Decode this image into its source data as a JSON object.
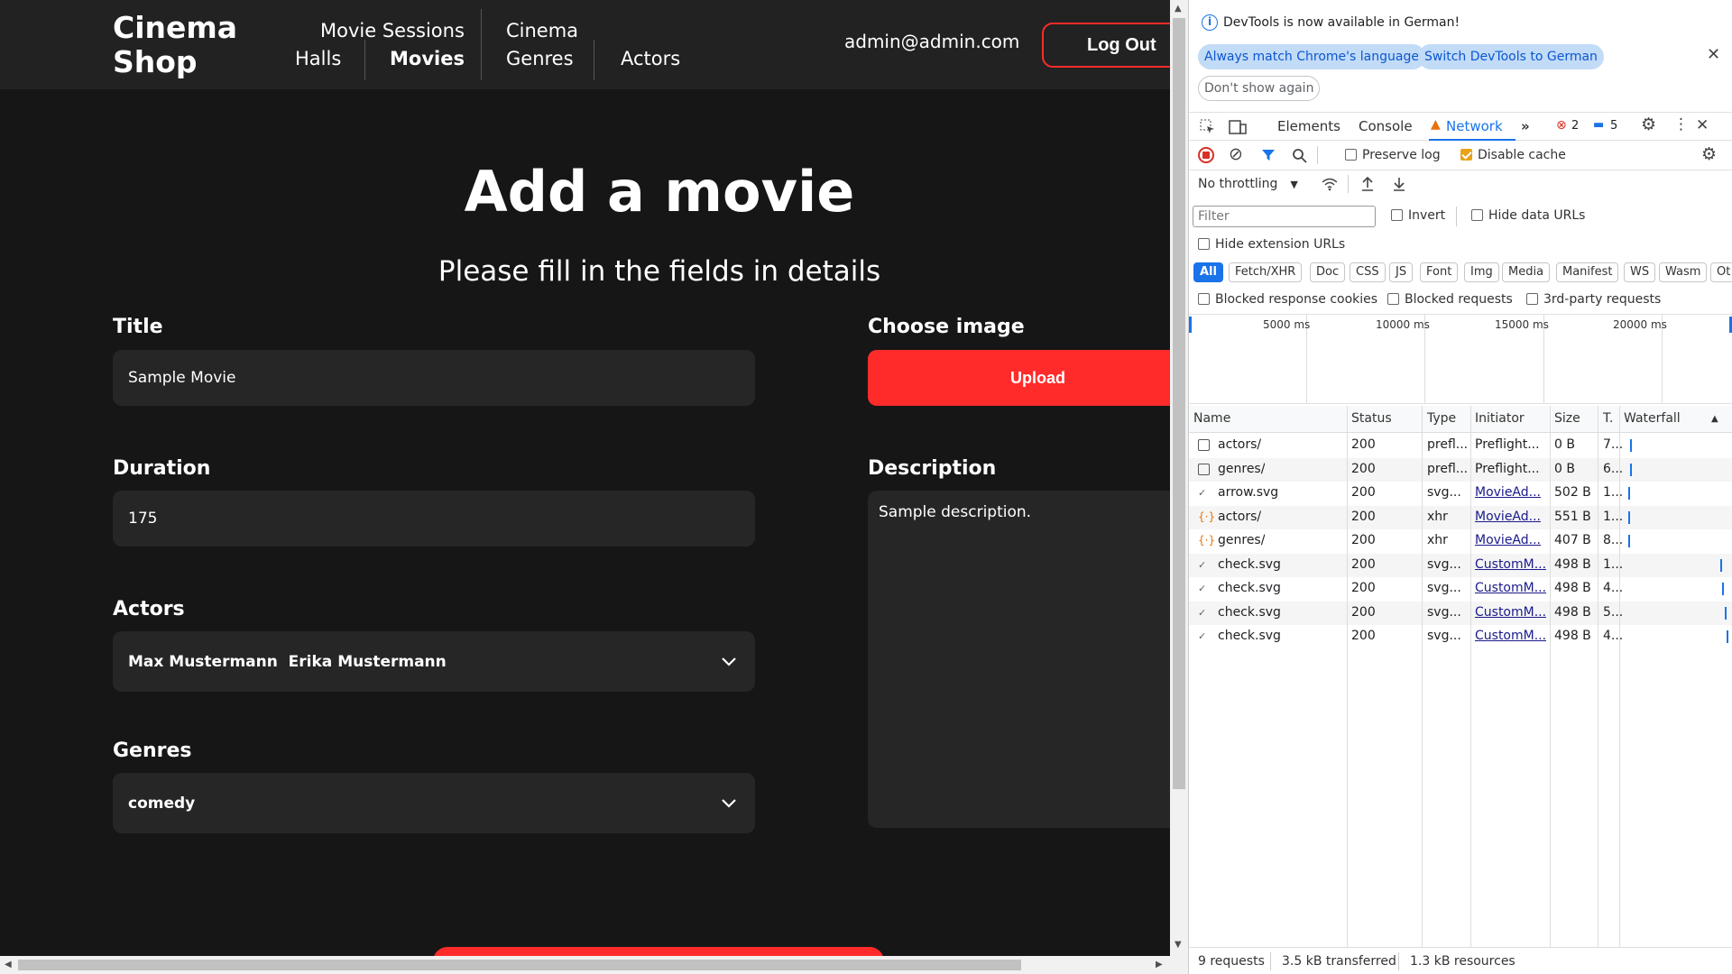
{
  "site": {
    "logo_line1": "Cinema",
    "logo_line2": "Shop",
    "nav": {
      "movie_sessions": "Movie Sessions",
      "halls": "Halls",
      "movies": "Movies",
      "cinema": "Cinema",
      "genres": "Genres",
      "actors": "Actors"
    },
    "user_email": "admin@admin.com",
    "logout_label": "Log Out"
  },
  "form": {
    "title": "Add a movie",
    "subtitle": "Please fill in the fields in details",
    "title_label": "Title",
    "title_value": "Sample  Movie",
    "duration_label": "Duration",
    "duration_value": "175",
    "actors_label": "Actors",
    "actors_value": "Max Mustermann  Erika Mustermann",
    "genres_label": "Genres",
    "genres_value": "comedy",
    "image_label": "Choose image",
    "upload_label": "Upload",
    "description_label": "Description",
    "description_value": "Sample description."
  },
  "devtools": {
    "info_text": "DevTools is now available in German!",
    "btn_match": "Always match Chrome's language",
    "btn_switch": "Switch DevTools to German",
    "btn_dont_show": "Don't show again",
    "tabs": {
      "elements": "Elements",
      "console": "Console",
      "network": "Network"
    },
    "error_count": "2",
    "message_count": "5",
    "preserve_log": "Preserve log",
    "disable_cache": "Disable cache",
    "throttling": "No throttling",
    "filter_placeholder": "Filter",
    "invert": "Invert",
    "hide_data_urls": "Hide data URLs",
    "hide_extension_urls": "Hide extension URLs",
    "types": [
      "All",
      "Fetch/XHR",
      "Doc",
      "CSS",
      "JS",
      "Font",
      "Img",
      "Media",
      "Manifest",
      "WS",
      "Wasm",
      "Ot"
    ],
    "blocked_cookies": "Blocked response cookies",
    "blocked_requests": "Blocked requests",
    "third_party": "3rd-party requests",
    "timeline_ticks": [
      "5000 ms",
      "10000 ms",
      "15000 ms",
      "20000 ms"
    ],
    "columns": {
      "name": "Name",
      "status": "Status",
      "type": "Type",
      "initiator": "Initiator",
      "size": "Size",
      "time": "T.",
      "waterfall": "Waterfall"
    },
    "requests": [
      {
        "name": "actors/",
        "status": "200",
        "type": "prefl...",
        "initiator": "Preflight...",
        "size": "0 B",
        "time": "7...",
        "kind": "preflight",
        "wf": 0.04
      },
      {
        "name": "genres/",
        "status": "200",
        "type": "prefl...",
        "initiator": "Preflight...",
        "size": "0 B",
        "time": "6...",
        "kind": "preflight",
        "wf": 0.04
      },
      {
        "name": "arrow.svg",
        "status": "200",
        "type": "svg...",
        "initiator": "MovieAd...",
        "size": "502 B",
        "time": "1...",
        "kind": "svg",
        "wf": 0.02
      },
      {
        "name": "actors/",
        "status": "200",
        "type": "xhr",
        "initiator": "MovieAd...",
        "size": "551 B",
        "time": "1...",
        "kind": "xhr",
        "wf": 0.02
      },
      {
        "name": "genres/",
        "status": "200",
        "type": "xhr",
        "initiator": "MovieAd...",
        "size": "407 B",
        "time": "8...",
        "kind": "xhr",
        "wf": 0.02
      },
      {
        "name": "check.svg",
        "status": "200",
        "type": "svg...",
        "initiator": "CustomM...",
        "size": "498 B",
        "time": "1...",
        "kind": "svg",
        "wf": 0.93
      },
      {
        "name": "check.svg",
        "status": "200",
        "type": "svg...",
        "initiator": "CustomM...",
        "size": "498 B",
        "time": "4...",
        "kind": "svg",
        "wf": 0.95
      },
      {
        "name": "check.svg",
        "status": "200",
        "type": "svg...",
        "initiator": "CustomM...",
        "size": "498 B",
        "time": "5...",
        "kind": "svg",
        "wf": 0.97
      },
      {
        "name": "check.svg",
        "status": "200",
        "type": "svg...",
        "initiator": "CustomM...",
        "size": "498 B",
        "time": "4...",
        "kind": "svg",
        "wf": 0.99
      }
    ],
    "status_bar": {
      "requests": "9 requests",
      "transferred": "3.5 kB transferred",
      "resources": "1.3 kB resources"
    }
  },
  "colors": {
    "accent": "#ff2b2b",
    "page_bg": "#161616",
    "header_bg": "#222222",
    "field_bg": "#262626",
    "devtools_blue": "#1a73e8"
  }
}
